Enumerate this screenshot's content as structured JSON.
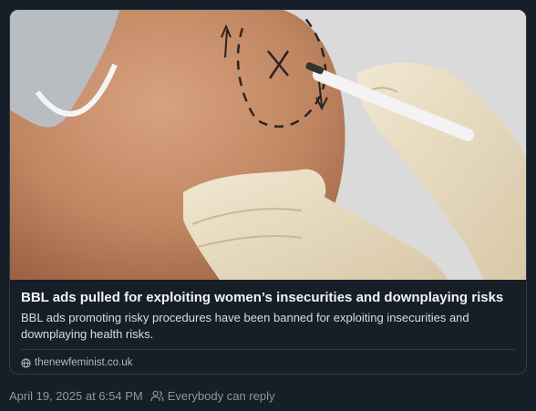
{
  "link_card": {
    "image_alt": "Gloved hands marking a buttock with a surgical pen",
    "title": "BBL ads pulled for exploiting women’s insecurities and downplaying risks",
    "description": "BBL ads promoting risky procedures have been banned for exploiting insecurities and downplaying health risks.",
    "domain": "thenewfeminist.co.uk"
  },
  "post": {
    "timestamp": "April 19, 2025 at 6:54 PM",
    "reply_setting": "Everybody can reply"
  },
  "icons": {
    "domain": "globe-icon",
    "reply": "people-icon"
  },
  "colors": {
    "background": "#161e27",
    "border": "#2e3a47",
    "muted_text": "#8b98a5"
  }
}
